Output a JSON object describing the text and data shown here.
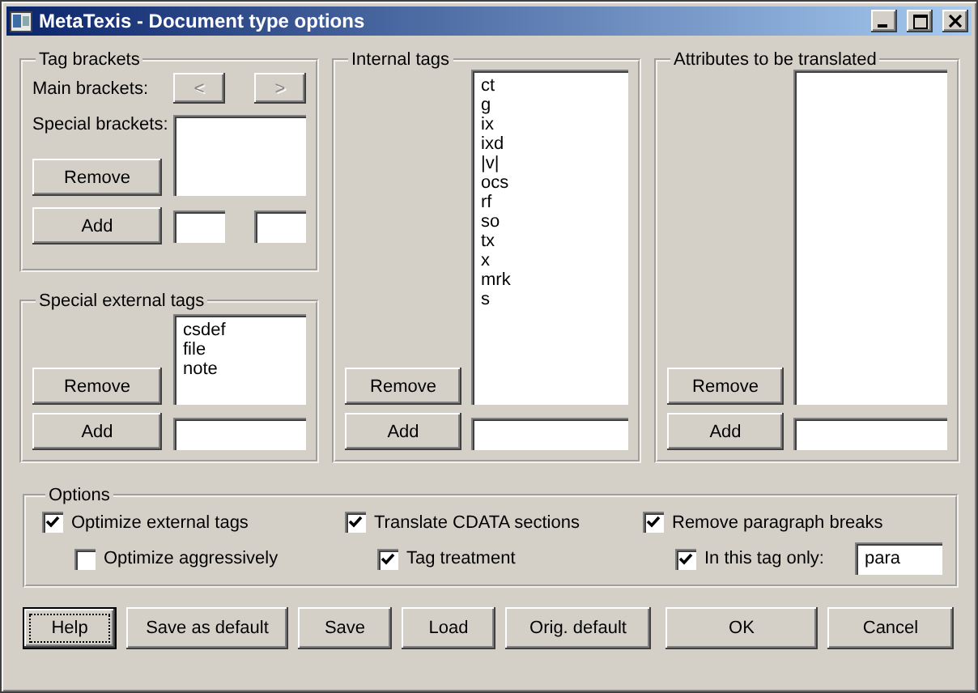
{
  "window": {
    "title": "MetaTexis - Document type options"
  },
  "tag_brackets": {
    "title": "Tag brackets",
    "main_label": "Main brackets:",
    "main_buttons": [
      {
        "label": "<",
        "disabled": true
      },
      {
        "label": ">",
        "disabled": true
      }
    ],
    "special_label": "Special brackets:",
    "remove": "Remove",
    "add": "Add"
  },
  "special_external_tags": {
    "title": "Special external tags",
    "items": [
      "csdef",
      "file",
      "note"
    ],
    "remove": "Remove",
    "add": "Add"
  },
  "internal_tags": {
    "title": "Internal tags",
    "items": [
      "ct",
      "g",
      "ix",
      "ixd",
      "|v|",
      "ocs",
      "rf",
      "so",
      "tx",
      "x",
      "mrk",
      "s"
    ],
    "remove": "Remove",
    "add": "Add"
  },
  "attributes": {
    "title": "Attributes to be translated",
    "remove": "Remove",
    "add": "Add"
  },
  "options": {
    "title": "Options",
    "columns": [
      {
        "main": {
          "label": "Optimize external tags",
          "checked": true
        },
        "sub": {
          "label": "Optimize aggressively",
          "checked": false
        }
      },
      {
        "main": {
          "label": "Translate CDATA sections",
          "checked": true
        },
        "sub": {
          "label": "Tag treatment",
          "checked": true
        }
      },
      {
        "main": {
          "label": "Remove paragraph breaks",
          "checked": true
        },
        "sub": {
          "label": "In this tag only:",
          "checked": true,
          "value": "para"
        }
      }
    ]
  },
  "buttons": [
    {
      "label": "Help",
      "focused": true
    },
    {
      "label": "Save as default",
      "focused": false
    },
    {
      "label": "Save",
      "focused": false
    },
    {
      "label": "Load",
      "focused": false
    },
    {
      "label": "Orig. default",
      "focused": false
    },
    {
      "label": "OK",
      "focused": false
    },
    {
      "label": "Cancel",
      "focused": false
    }
  ]
}
